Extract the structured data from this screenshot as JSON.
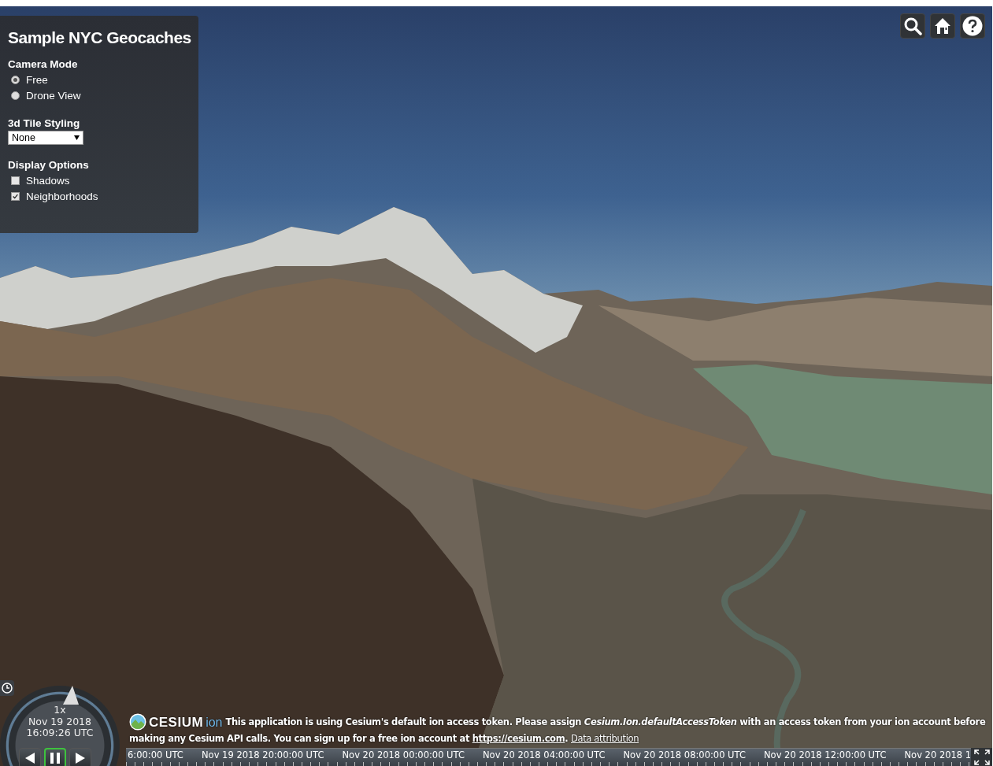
{
  "panel": {
    "title": "Sample NYC Geocaches",
    "sections": [
      {
        "kind": "radio",
        "heading": "Camera Mode",
        "options": [
          {
            "label": "Free",
            "selected": true
          },
          {
            "label": "Drone View",
            "selected": false
          }
        ]
      },
      {
        "kind": "select",
        "heading": "3d Tile Styling",
        "value": "None"
      },
      {
        "kind": "checkbox",
        "heading": "Display Options",
        "options": [
          {
            "label": "Shadows",
            "checked": false
          },
          {
            "label": "Neighborhoods",
            "checked": true
          }
        ]
      }
    ]
  },
  "animation": {
    "speed": "1x",
    "date": "Nov 19 2018",
    "time": "16:09:26 UTC",
    "paused": true
  },
  "credits": {
    "logo_text": "CESIUM",
    "logo_suffix": "ion",
    "message_line_1": "This application is using Cesium's default ion access token. Please assign *Cesium.Ion.defaultAccessToken* with an access token from your ion account before",
    "message_line_2": "making any Cesium API calls. You can sign up for a free ion account at ",
    "link": "https://cesium.com",
    "link_suffix": ".",
    "attribution": "Data attribution"
  },
  "timeline": {
    "labels": [
      "6:00:00 UTC",
      "Nov 19 2018 20:00:00 UTC",
      "Nov 20 2018 00:00:00 UTC",
      "Nov 20 2018 04:00:00 UTC",
      "Nov 20 2018 08:00:00 UTC",
      "Nov 20 2018 12:00:00 UTC",
      "Nov 20 2018 1"
    ]
  }
}
